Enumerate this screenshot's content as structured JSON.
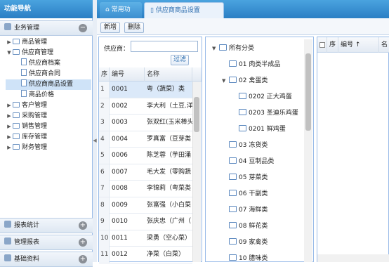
{
  "sidebar": {
    "title": "功能导航",
    "collapse_icon": "double-chevron-left-icon",
    "sections": [
      {
        "label": "业务管理",
        "toggle": "−"
      },
      {
        "label": "报表统计",
        "toggle": "+"
      },
      {
        "label": "管理报表",
        "toggle": "+"
      },
      {
        "label": "基础资料",
        "toggle": "+"
      }
    ],
    "tree": [
      {
        "label": "商品管理",
        "level": 0,
        "expanded": false
      },
      {
        "label": "供应商管理",
        "level": 0,
        "expanded": true
      },
      {
        "label": "供应商档案",
        "level": 1
      },
      {
        "label": "供应商合同",
        "level": 1
      },
      {
        "label": "供应商商品设置",
        "level": 1,
        "selected": true
      },
      {
        "label": "商品价格",
        "level": 1
      },
      {
        "label": "客户管理",
        "level": 0,
        "expanded": false
      },
      {
        "label": "采购管理",
        "level": 0,
        "expanded": false
      },
      {
        "label": "销售管理",
        "level": 0,
        "expanded": false
      },
      {
        "label": "库存管理",
        "level": 0,
        "expanded": false
      },
      {
        "label": "财务管理",
        "level": 0,
        "expanded": false
      }
    ]
  },
  "tabs": {
    "home": "常用功能",
    "current": "供应商商品设置"
  },
  "toolbar": {
    "add": "新增",
    "delete": "删除"
  },
  "filter": {
    "label": "供应商：",
    "value": "",
    "button": "过滤"
  },
  "grid": {
    "headers": [
      "序",
      "编号",
      "名称"
    ],
    "rows": [
      {
        "n": "1",
        "code": "0001",
        "name": "粤（蔬菜）类"
      },
      {
        "n": "2",
        "code": "0002",
        "name": "李大利（土豆.洋"
      },
      {
        "n": "3",
        "code": "0003",
        "name": "张双红(玉米棒头"
      },
      {
        "n": "4",
        "code": "0004",
        "name": "罗真富（豆芽类"
      },
      {
        "n": "5",
        "code": "0006",
        "name": "陈芝蓉（芋田涌"
      },
      {
        "n": "6",
        "code": "0007",
        "name": "毛大发（零购蔬"
      },
      {
        "n": "7",
        "code": "0008",
        "name": "李锦莉（粤菜类"
      },
      {
        "n": "8",
        "code": "0009",
        "name": "张富强（小白菜"
      },
      {
        "n": "9",
        "code": "0010",
        "name": "张庆忠（广州（"
      },
      {
        "n": "10",
        "code": "0011",
        "name": "梁勇（空心菜）"
      },
      {
        "n": "11",
        "code": "0012",
        "name": "净菜（白菜）"
      }
    ]
  },
  "categories": [
    {
      "label": "所有分类",
      "level": 0,
      "expanded": true
    },
    {
      "label": "01 肉类半成品",
      "level": 1
    },
    {
      "label": "02 禽蛋类",
      "level": 1,
      "expanded": true
    },
    {
      "label": "0202 正大鸡蛋",
      "level": 2
    },
    {
      "label": "0203 圣迪乐鸡蛋",
      "level": 2
    },
    {
      "label": "0201 鲜鸡蛋",
      "level": 2
    },
    {
      "label": "03 冻货类",
      "level": 1
    },
    {
      "label": "04 豆制品类",
      "level": 1
    },
    {
      "label": "05 芽菜类",
      "level": 1
    },
    {
      "label": "06 干副类",
      "level": 1
    },
    {
      "label": "07 海鲜类",
      "level": 1
    },
    {
      "label": "08 鲜花类",
      "level": 1
    },
    {
      "label": "09 家禽类",
      "level": 1
    },
    {
      "label": "10 腊味类",
      "level": 1
    }
  ],
  "right_grid": {
    "headers": [
      "序",
      "编号 ↑",
      "名"
    ]
  }
}
